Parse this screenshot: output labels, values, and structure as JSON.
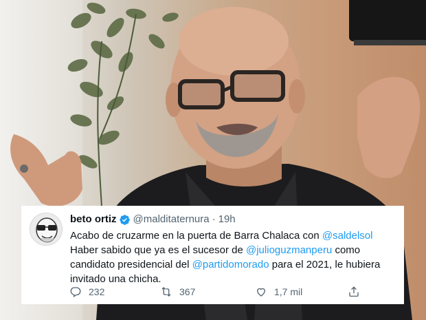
{
  "tweet": {
    "display_name": "beto ortiz",
    "handle": "@malditaternura",
    "separator": "·",
    "time": "19h",
    "text_parts": {
      "p1": "Acabo de cruzarme en la puerta de Barra Chalaca con ",
      "m1": "@saldelsol",
      "p2": " Haber sabido que ya es el sucesor de ",
      "m2": "@julioguzmanperu",
      "p3": " como candidato presidencial del ",
      "m3": "@partidomorado",
      "p4": " para el 2021, le hubiera invitado una chicha."
    },
    "actions": {
      "replies": "232",
      "retweets": "367",
      "likes": "1,7 mil"
    },
    "icons": {
      "verified": "verified-badge-icon",
      "reply": "reply-icon",
      "retweet": "retweet-icon",
      "like": "heart-icon",
      "share": "share-icon"
    },
    "colors": {
      "text": "#0f1419",
      "secondary": "#536471",
      "link": "#1d9bf0",
      "card_bg": "#ffffff"
    }
  }
}
